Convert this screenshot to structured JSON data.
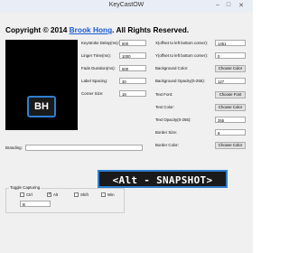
{
  "window": {
    "title": "KeyCastOW"
  },
  "header": {
    "copyright_prefix": "Copyright © 2014 ",
    "author": "Brook Hong",
    "copyright_suffix": ". All Rights Reserved."
  },
  "preview": {
    "logo_text": "BH"
  },
  "left_settings": [
    {
      "label": "Keystroke Delay(ms):",
      "value": "500"
    },
    {
      "label": "Linger Time(ms):",
      "value": "1000"
    },
    {
      "label": "Fade Duration(ms):",
      "value": "600"
    },
    {
      "label": "Label Spacing:",
      "value": "30"
    },
    {
      "label": "Corner Size:",
      "value": "16"
    }
  ],
  "right_settings": {
    "x_offset": {
      "label": "X(offset to left bottom corner):",
      "value": "1451"
    },
    "y_offset": {
      "label": "Y(offset to left bottom corner):",
      "value": "0"
    },
    "background_color": {
      "label": "Background Color:",
      "button": "Choose Color"
    },
    "background_opacity": {
      "label": "Background Opacity(0-255):",
      "value": "127"
    },
    "text_font": {
      "label": "Text Font:",
      "button": "Choose Font"
    },
    "text_color": {
      "label": "Text Color:",
      "button": "Choose Color"
    },
    "text_opacity": {
      "label": "Text Opacity(0-255):",
      "value": "255"
    },
    "border_size": {
      "label": "Border Size:",
      "value": "8"
    },
    "border_color": {
      "label": "Border Color:",
      "button": "Choose Color"
    }
  },
  "branding": {
    "label": "Branding:",
    "value": ""
  },
  "toggle_capturing": {
    "label": "Toggle Capturing",
    "options": [
      {
        "label": "Ctrl",
        "checked": false
      },
      {
        "label": "Alt",
        "checked": true
      },
      {
        "label": "Shift",
        "checked": false
      },
      {
        "label": "Win",
        "checked": false
      }
    ],
    "key_value": "B"
  },
  "key_overlay": {
    "text": "<Alt - SNAPSHOT>"
  }
}
